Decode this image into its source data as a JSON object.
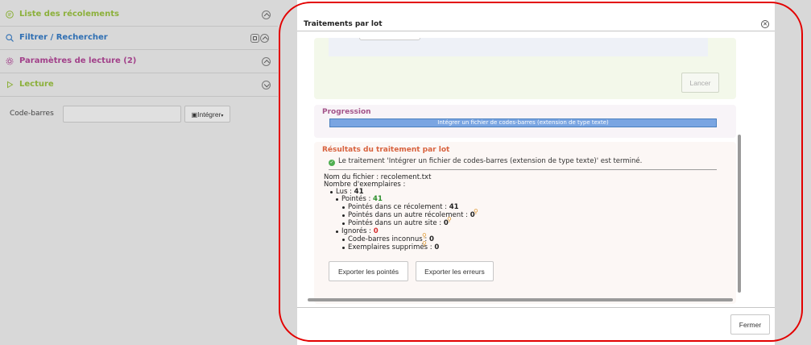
{
  "sidebar": {
    "items": [
      {
        "label": "Liste des récolements",
        "icon": "list-icon",
        "color": "#8cb03b"
      },
      {
        "label": "Filtrer / Rechercher",
        "icon": "search-icon",
        "color": "#2f6fb3"
      },
      {
        "label": "Paramètres de lecture (2)",
        "icon": "gear-icon",
        "color": "#a2418a"
      },
      {
        "label": "Lecture",
        "icon": "play-icon",
        "color": "#8cb03b"
      }
    ],
    "barcode_label": "Code-barres",
    "barcode_value": "",
    "integrer_label": "Intégrer"
  },
  "modal": {
    "title": "Traitements par lot",
    "lancer_label": "Lancer",
    "progress": {
      "title": "Progression",
      "bar_text": "Intégrer un fichier de codes-barres (extension de type texte)",
      "value": 1.0
    },
    "results": {
      "title": "Résultats du traitement par lot",
      "success": "Le traitement 'Intégrer un fichier de codes-barres (extension de type texte)' est terminé.",
      "filename_line": "Nom du fichier : recolement.txt",
      "count_line": "Nombre d'exemplaires :",
      "lus_label": "Lus :",
      "lus_value": "41",
      "pointes_label": "Pointés :",
      "pointes_value": "41",
      "p_this_label": "Pointés dans ce récolement :",
      "p_this_value": "41",
      "p_other_label": "Pointés dans un autre récolement :",
      "p_other_value": "0",
      "p_site_label": "Pointés dans un autre site :",
      "p_site_value": "0",
      "ignores_label": "Ignorés :",
      "ignores_value": "0",
      "unknown_label": "Code-barres inconnus :",
      "unknown_value": "0",
      "deleted_label": "Exemplaires supprimés :",
      "deleted_value": "0",
      "export_pointes": "Exporter les pointés",
      "export_erreurs": "Exporter les erreurs"
    },
    "fermer_label": "Fermer"
  }
}
